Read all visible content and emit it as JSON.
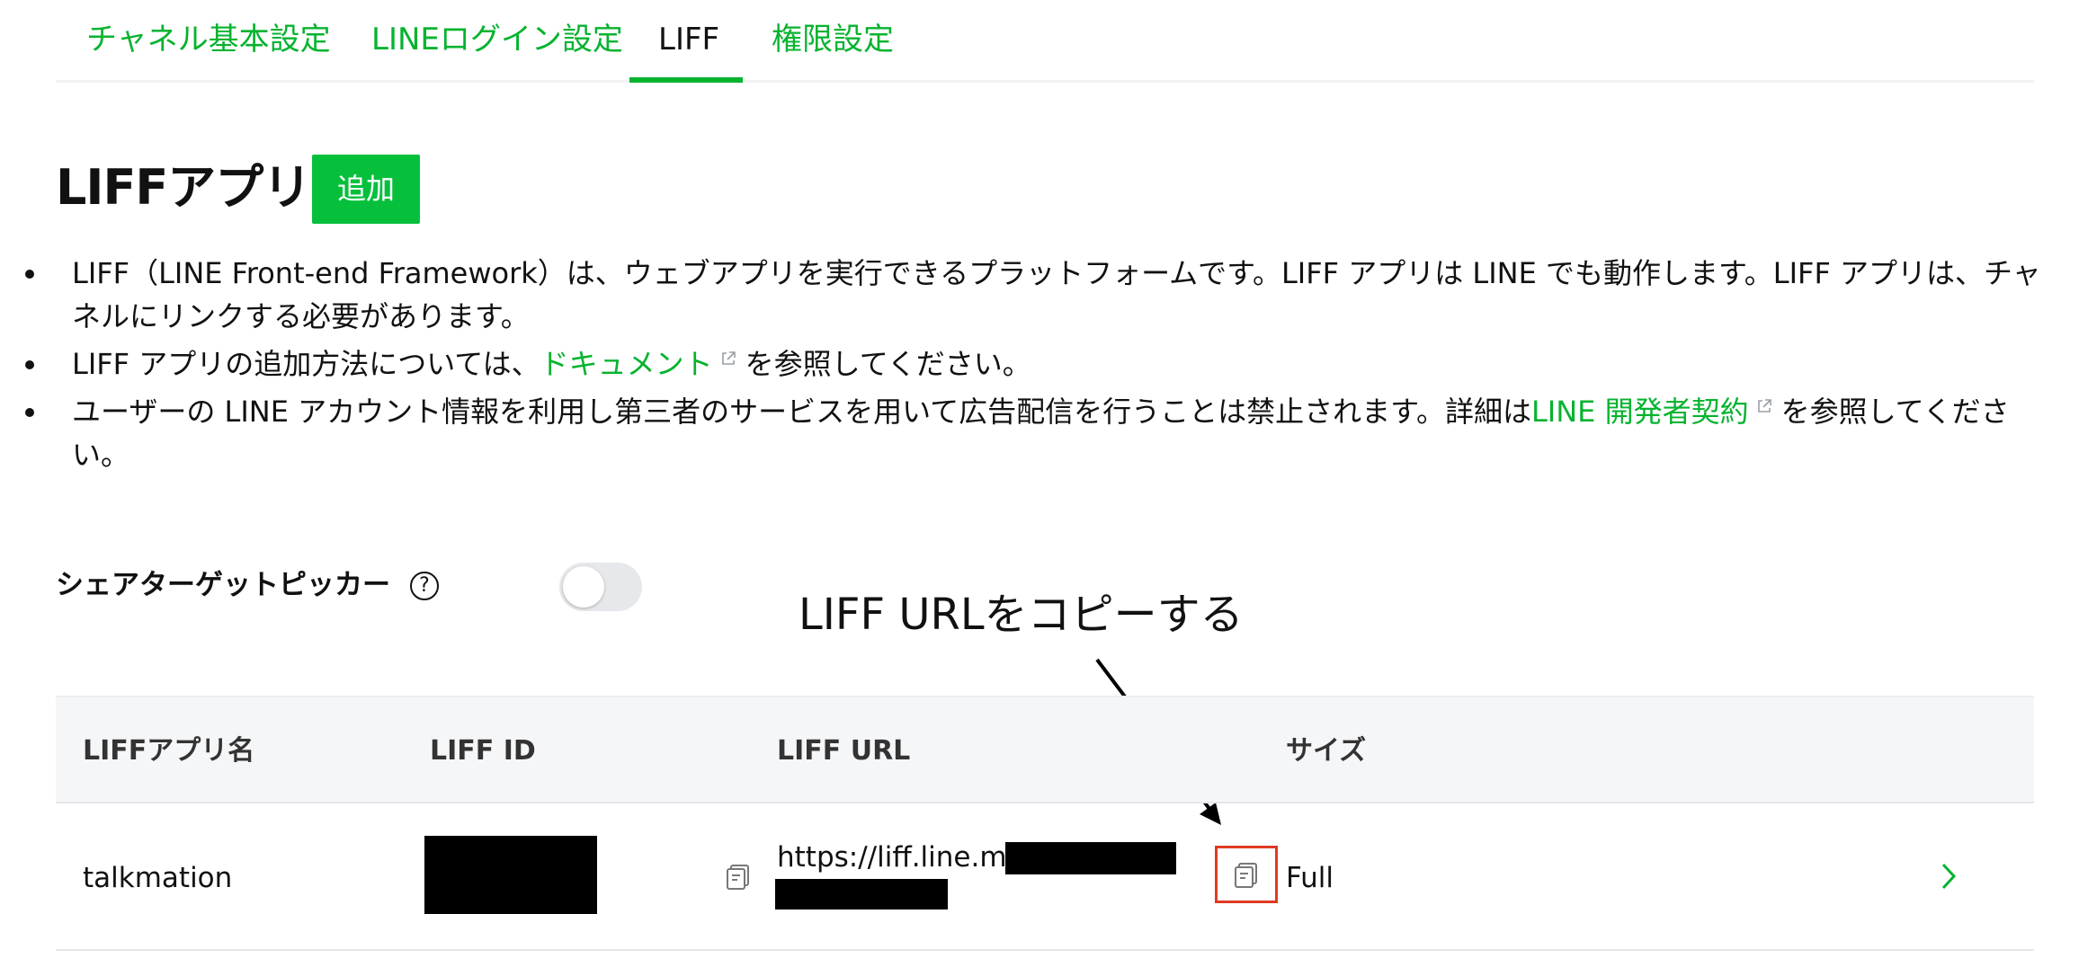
{
  "tabs": [
    {
      "label": "チャネル基本設定",
      "active": false
    },
    {
      "label": "LINEログイン設定",
      "active": false
    },
    {
      "label": "LIFF",
      "active": true
    },
    {
      "label": "権限設定",
      "active": false
    }
  ],
  "page": {
    "title": "LIFFアプリ",
    "add_button": "追加"
  },
  "description": {
    "bullet1_line1": "LIFF（LINE Front-end Framework）は、ウェブアプリを実行できるプラットフォームです。LIFF アプリは LINE でも動作します。LIFF アプリは、チャ",
    "bullet1_line2": "ネルにリンクする必要があります。",
    "bullet2_before": "LIFF アプリの追加方法については、",
    "bullet2_link": "ドキュメント",
    "bullet2_after": "を参照してください。",
    "bullet3_before": "ユーザーの LINE アカウント情報を利用し第三者のサービスを用いて広告配信を行うことは禁止されます。詳細は",
    "bullet3_link": "LINE 開発者契約",
    "bullet3_after": "を参照してくださ",
    "bullet3_line2": "い。"
  },
  "share_target_picker": {
    "label": "シェアターゲットピッカー",
    "help": "?",
    "enabled": false
  },
  "annotation": {
    "text": "LIFF URLをコピーする"
  },
  "table": {
    "headers": [
      "LIFFアプリ名",
      "LIFF ID",
      "LIFF URL",
      "サイズ"
    ],
    "rows": [
      {
        "name": "talkmation",
        "url_prefix": "https://liff.line.me/",
        "size": "Full"
      }
    ]
  },
  "colors": {
    "accent": "#06b32f",
    "button": "#06c03c",
    "highlight": "#e03a24"
  },
  "icons": [
    "external-link-icon",
    "help-icon",
    "copy-icon",
    "chevron-right-icon"
  ]
}
